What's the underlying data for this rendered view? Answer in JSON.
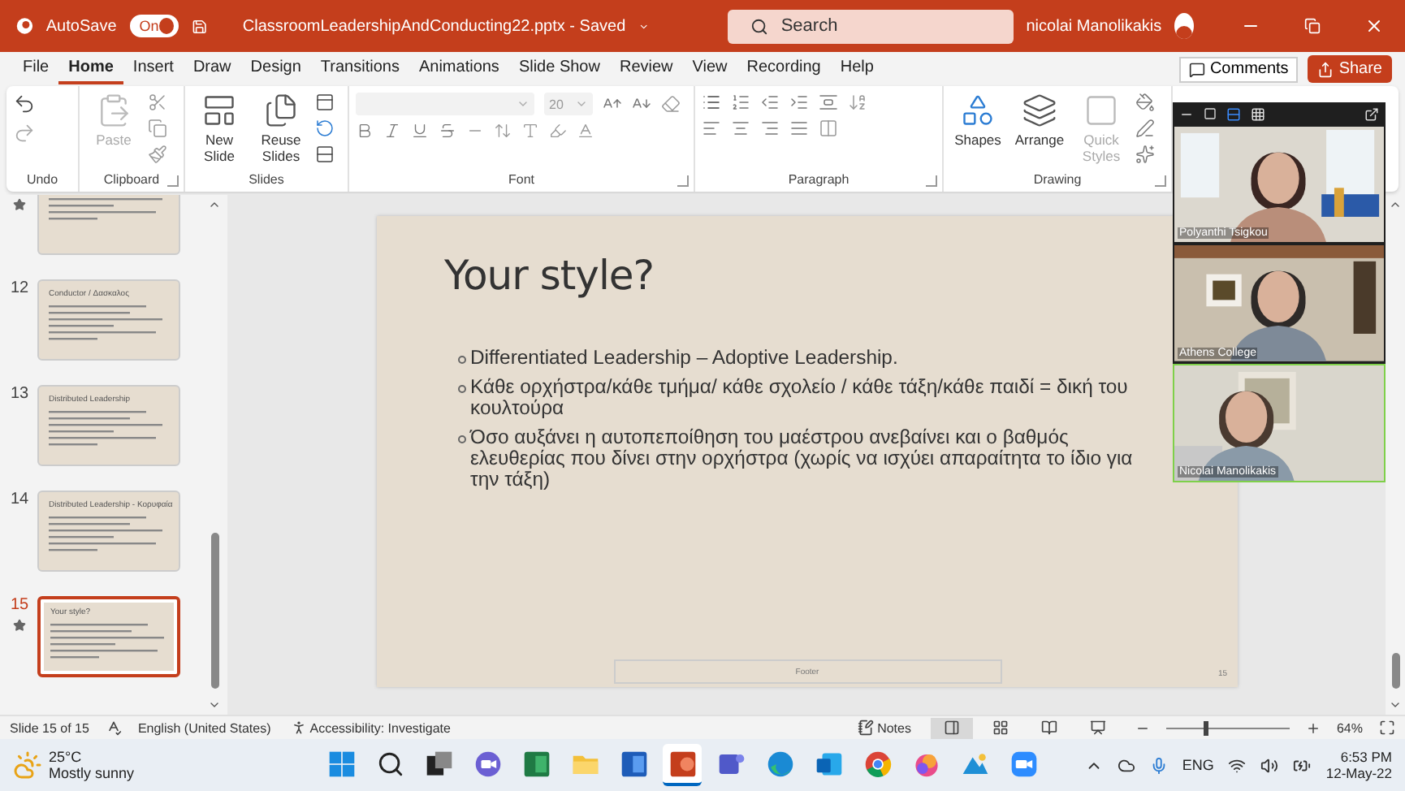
{
  "title_bar": {
    "autosave_label": "AutoSave",
    "autosave_on": true,
    "autosave_state": "On",
    "filename": "ClassroomLeadershipAndConducting22.pptx",
    "separator": "-",
    "status": "Saved",
    "search_placeholder": "Search",
    "user": "nicolai Manolikakis"
  },
  "menu_tabs": [
    {
      "label": "File",
      "selected": false
    },
    {
      "label": "Home",
      "selected": true
    },
    {
      "label": "Insert",
      "selected": false
    },
    {
      "label": "Draw",
      "selected": false
    },
    {
      "label": "Design",
      "selected": false
    },
    {
      "label": "Transitions",
      "selected": false
    },
    {
      "label": "Animations",
      "selected": false
    },
    {
      "label": "Slide Show",
      "selected": false
    },
    {
      "label": "Review",
      "selected": false
    },
    {
      "label": "View",
      "selected": false
    },
    {
      "label": "Recording",
      "selected": false
    },
    {
      "label": "Help",
      "selected": false
    }
  ],
  "comments_button": "Comments",
  "share_button": "Share",
  "ribbon": [
    {
      "kind": "undo",
      "label": "Undo"
    },
    {
      "kind": "clipboard",
      "label": "Clipboard",
      "buttons": [
        {
          "label": "Paste",
          "disabled": true
        }
      ]
    },
    {
      "kind": "slides",
      "label": "Slides",
      "buttons": [
        {
          "label": "New Slide",
          "disabled": false
        },
        {
          "label": "Reuse Slides",
          "disabled": false
        }
      ]
    },
    {
      "kind": "font",
      "label": "Font",
      "font_size": "20"
    },
    {
      "kind": "paragraph",
      "label": "Paragraph"
    },
    {
      "kind": "drawing",
      "label": "Drawing",
      "buttons": [
        {
          "label": "Shapes",
          "disabled": false
        },
        {
          "label": "Arrange",
          "disabled": false
        },
        {
          "label": "Quick Styles",
          "disabled": true
        }
      ]
    }
  ],
  "thumbnails": [
    {
      "selected": false,
      "transition": true
    },
    {
      "number": "12",
      "title": "Conductor / Δασκαλος",
      "selected": false,
      "transition": false
    },
    {
      "number": "13",
      "title": "Distributed Leadership",
      "selected": false,
      "transition": false
    },
    {
      "number": "14",
      "title": "Distributed Leadership - Κορυφαία",
      "selected": false,
      "transition": false
    },
    {
      "number": "15",
      "title": "Your style?",
      "selected": true,
      "transition": true
    }
  ],
  "slide": {
    "title": "Your style?",
    "bullets": [
      "Differentiated Leadership – Adoptive Leadership.",
      "Κάθε ορχήστρα/κάθε τμήμα/ κάθε σχολείο / κάθε τάξη/κάθε παιδί = δική του κουλτούρα",
      "Όσο αυξάνει η αυτοπεποίθηση του μαέστρου ανεβαίνει και ο βαθμός ελευθερίας που δίνει στην ορχήστρα (χωρίς να ισχύει απαραίτητα το ίδιο για την τάξη)"
    ],
    "footer": "Footer",
    "number": "15"
  },
  "video_call": {
    "participants": [
      {
        "name": "Polyanthi Tsigkou",
        "speaking": false
      },
      {
        "name": "Athens College",
        "speaking": false
      },
      {
        "name": "Nicolai Manolikakis",
        "speaking": true
      }
    ]
  },
  "status_bar": {
    "slide_info": "Slide 15 of 15",
    "language": "English (United States)",
    "accessibility": "Accessibility: Investigate",
    "notes": "Notes",
    "views": [
      {
        "kind": "normal",
        "selected": true
      },
      {
        "kind": "sorter",
        "selected": false
      },
      {
        "kind": "reading",
        "selected": false
      },
      {
        "kind": "slideshow",
        "selected": false
      }
    ],
    "zoom": {
      "level": 0.3,
      "reading": "64%"
    }
  },
  "taskbar": {
    "weather": {
      "temperature": "25°C",
      "condition": "Mostly sunny"
    },
    "apps": [
      {
        "kind": "start",
        "selected": false
      },
      {
        "kind": "search",
        "selected": false
      },
      {
        "kind": "taskview",
        "selected": false
      },
      {
        "kind": "chat",
        "selected": false
      },
      {
        "kind": "excel",
        "selected": false
      },
      {
        "kind": "folder",
        "selected": false
      },
      {
        "kind": "word",
        "selected": false
      },
      {
        "kind": "powerpoint",
        "selected": true
      },
      {
        "kind": "teams",
        "selected": false
      },
      {
        "kind": "edge",
        "selected": false
      },
      {
        "kind": "outlook",
        "selected": false
      },
      {
        "kind": "chrome",
        "selected": false
      },
      {
        "kind": "paint",
        "selected": false
      },
      {
        "kind": "photos",
        "selected": false
      },
      {
        "kind": "zoom",
        "selected": false
      }
    ],
    "language": "ENG",
    "time": "6:53 PM",
    "date": "12-May-22"
  }
}
